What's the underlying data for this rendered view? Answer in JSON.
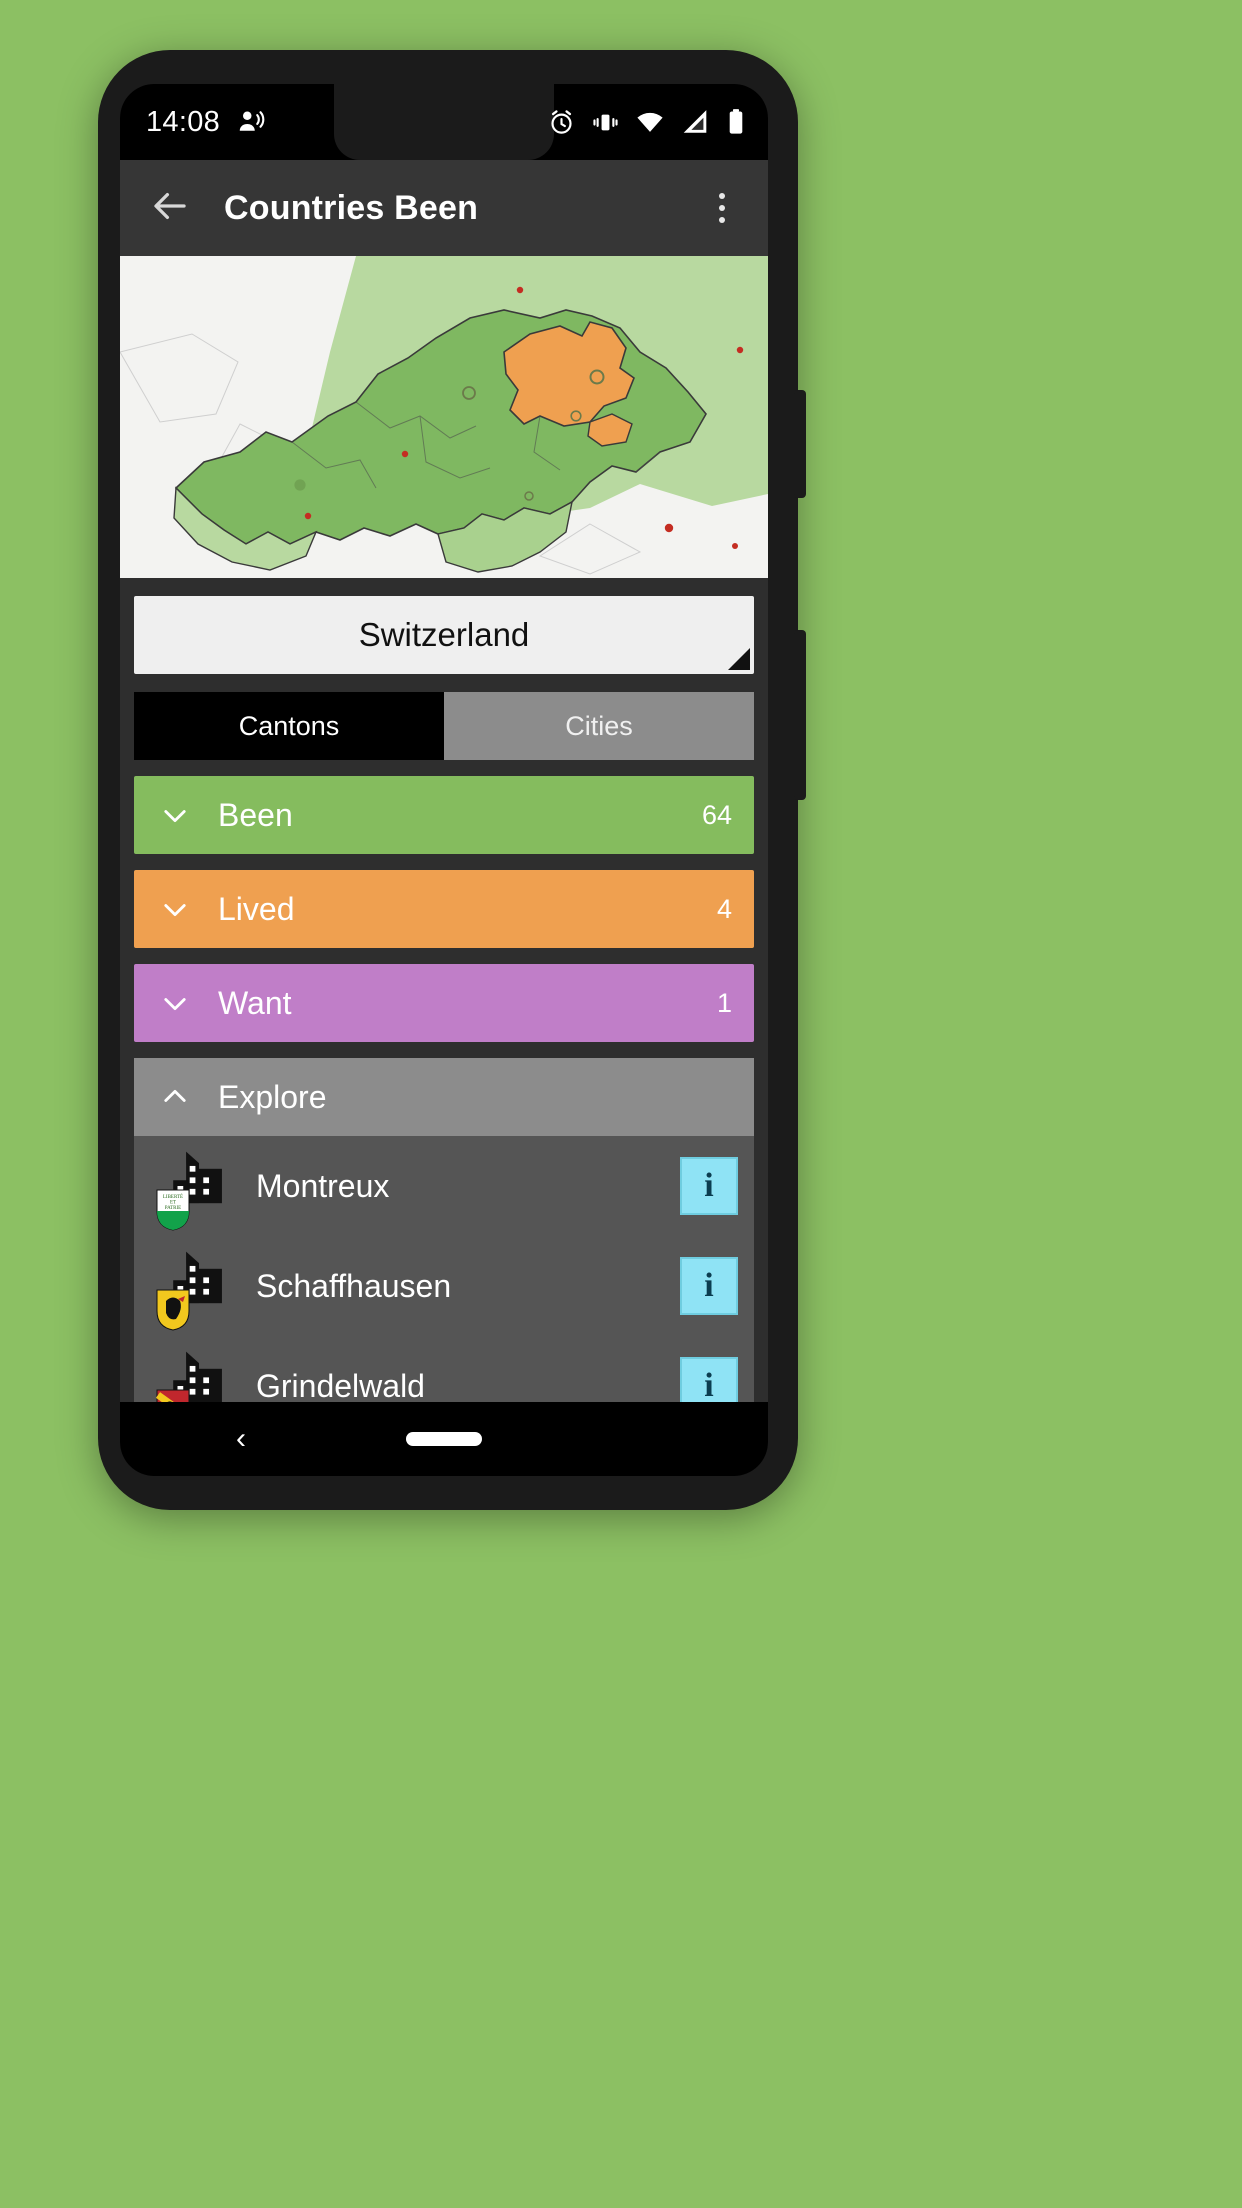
{
  "status_bar": {
    "time": "14:08",
    "left_icons": [
      "person-voice-icon"
    ],
    "right_icons": [
      "alarm-icon",
      "vibrate-icon",
      "wifi-icon",
      "signal-icon",
      "battery-icon"
    ]
  },
  "app_bar": {
    "back_icon": "back-arrow-icon",
    "title": "Countries Been",
    "overflow_icon": "overflow-menu-icon"
  },
  "map": {
    "alt": "Map of Switzerland with cantons shaded green and orange"
  },
  "spinner": {
    "selected": "Switzerland",
    "caret_icon": "spinner-caret-icon"
  },
  "tabs": [
    {
      "label": "Cantons",
      "active": true
    },
    {
      "label": "Cities",
      "active": false
    }
  ],
  "categories": [
    {
      "label": "Been",
      "count": "64",
      "color": "#85bc5e",
      "expanded": false,
      "chevron": "chevron-down-icon"
    },
    {
      "label": "Lived",
      "count": "4",
      "color": "#efa050",
      "expanded": false,
      "chevron": "chevron-down-icon"
    },
    {
      "label": "Want",
      "count": "1",
      "color": "#c07ec8",
      "expanded": false,
      "chevron": "chevron-down-icon"
    }
  ],
  "explore": {
    "label": "Explore",
    "chevron": "chevron-up-icon",
    "header_color": "#8c8c8c",
    "row_color": "#555555",
    "items": [
      {
        "name": "Montreux",
        "icon": "city-buildings-icon",
        "badge": "vaud-coat-of-arms",
        "info": "i"
      },
      {
        "name": "Schaffhausen",
        "icon": "city-buildings-icon",
        "badge": "schaffhausen-coat-of-arms",
        "info": "i"
      },
      {
        "name": "Grindelwald",
        "icon": "city-buildings-icon",
        "badge": "bern-coat-of-arms",
        "info": "i"
      }
    ]
  },
  "nav_bar": {
    "back_icon": "nav-back-icon",
    "home_pill": "nav-home-pill"
  },
  "colors": {
    "page_background": "#8cc063",
    "app_bar": "#363636",
    "screen_background": "#2e2e2e",
    "been": "#85bc5e",
    "lived": "#efa050",
    "want": "#c07ec8",
    "info_button": "#8fe3f5"
  }
}
